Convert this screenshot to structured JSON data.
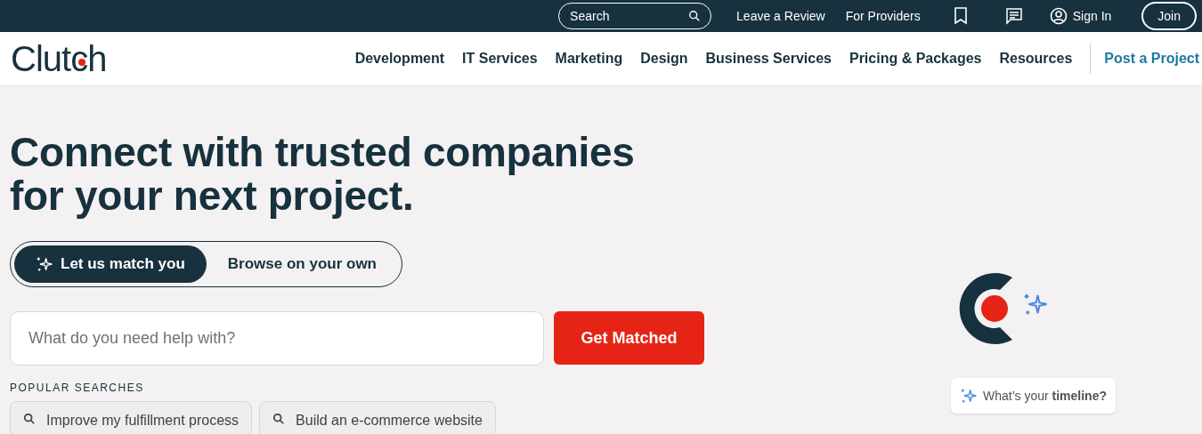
{
  "top_bar": {
    "search": {
      "placeholder": "Search"
    },
    "links": [
      "Leave a Review",
      "For Providers"
    ],
    "sign_in": "Sign In",
    "join": "Join"
  },
  "header": {
    "logo": "Clutch",
    "nav": [
      "Development",
      "IT Services",
      "Marketing",
      "Design",
      "Business Services",
      "Pricing & Packages",
      "Resources"
    ],
    "cta": "Post a Project"
  },
  "hero": {
    "headline": "Connect with trusted companies for your next project.",
    "mode_tabs": [
      {
        "label": "Let us match you",
        "selected": true
      },
      {
        "label": "Browse on your own",
        "selected": false
      }
    ],
    "search": {
      "placeholder": "What do you need help with?"
    },
    "button": "Get Matched",
    "popular_label": "POPULAR SEARCHES",
    "popular": [
      "Improve my fulfillment process",
      "Build an e-commerce website"
    ],
    "prompt_card": "What’s your **timeline?**"
  }
}
